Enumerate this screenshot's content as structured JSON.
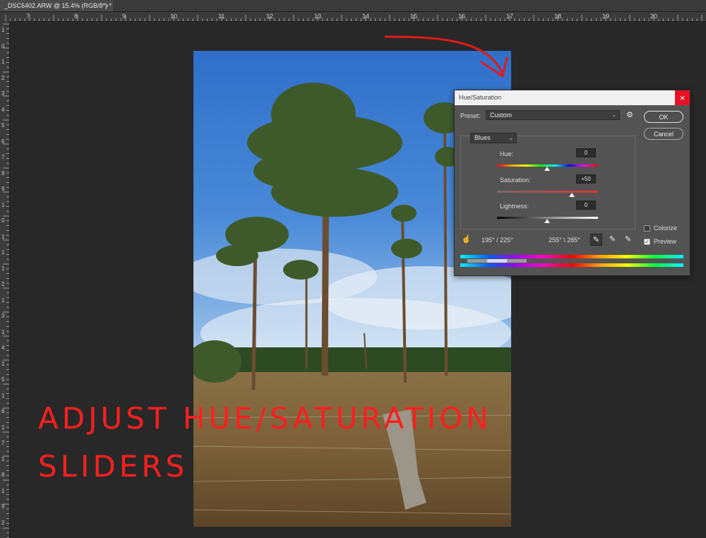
{
  "document": {
    "tab_title": "_DSC6402.ARW @ 15.4% (RGB/8*) *",
    "tab_close": "×"
  },
  "rulers": {
    "top": [
      "7",
      "8",
      "9",
      "10",
      "11",
      "12",
      "13",
      "14",
      "15",
      "16",
      "17",
      "18",
      "19",
      "20"
    ],
    "left": [
      "1",
      "0",
      "1",
      "2",
      "3",
      "4",
      "5",
      "6",
      "7",
      "8",
      "9",
      "1",
      "0",
      "1",
      "1",
      "1",
      "2",
      "1",
      "3",
      "1",
      "4",
      "1",
      "5",
      "1",
      "6",
      "1",
      "7",
      "1",
      "8",
      "1",
      "9",
      "2"
    ]
  },
  "dialog": {
    "title": "Hue/Saturation",
    "close": "×",
    "preset_label": "Preset:",
    "preset_value": "Custom",
    "ok": "OK",
    "cancel": "Cancel",
    "channel": "Blues",
    "hue_label": "Hue:",
    "hue_value": "0",
    "saturation_label": "Saturation:",
    "saturation_value": "+50",
    "lightness_label": "Lightness:",
    "lightness_value": "0",
    "range_left": "195° / 225°",
    "range_right": "255° \\ 285°",
    "colorize_label": "Colorize",
    "colorize_checked": false,
    "preview_label": "Preview",
    "preview_checked": true
  },
  "overlay": {
    "line1": "ADJUST HUE/SATURATION",
    "line2": "SLIDERS",
    "color": "#ff1f1f"
  },
  "icons": [
    "settings-gear-icon",
    "hand-target-icon",
    "eyedropper-icon",
    "eyedropper-add-icon",
    "eyedropper-subtract-icon"
  ]
}
